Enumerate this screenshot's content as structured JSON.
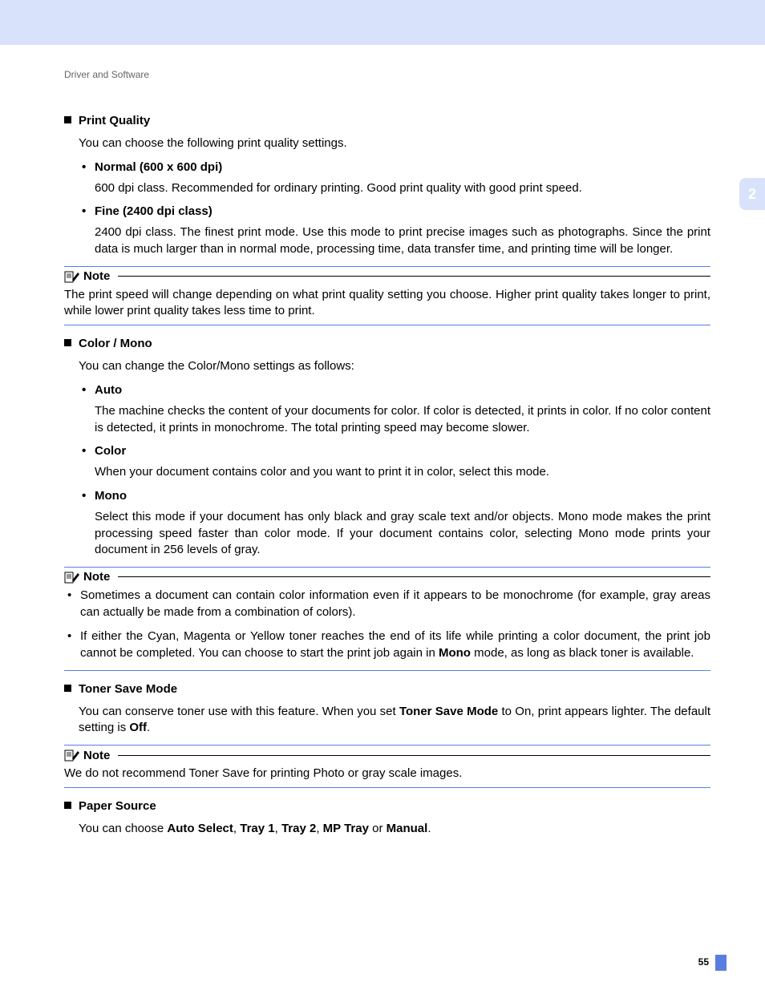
{
  "breadcrumb": "Driver and Software",
  "chapter_tab": "2",
  "page_number": "55",
  "note_label": "Note",
  "sections": {
    "print_quality": {
      "title": "Print Quality",
      "intro": "You can choose the following print quality settings.",
      "items": {
        "normal": {
          "title": "Normal (600 x 600 dpi)",
          "body": "600 dpi class. Recommended for ordinary printing. Good print quality with good print speed."
        },
        "fine": {
          "title": "Fine (2400 dpi class)",
          "body": "2400 dpi class. The finest print mode. Use this mode to print precise images such as photographs. Since the print data is much larger than in normal mode, processing time, data transfer time, and printing time will be longer."
        }
      },
      "note": "The print speed will change depending on what print quality setting you choose. Higher print quality takes longer to print, while lower print quality takes less time to print."
    },
    "color_mono": {
      "title": "Color / Mono",
      "intro": "You can change the Color/Mono settings as follows:",
      "items": {
        "auto": {
          "title": "Auto",
          "body": "The machine checks the content of your documents for color. If color is detected, it prints in color. If no color content is detected, it prints in monochrome. The total printing speed may become slower."
        },
        "color": {
          "title": "Color",
          "body": "When your document contains color and you want to print it in color, select this mode."
        },
        "mono": {
          "title": "Mono",
          "body": "Select this mode if your document has only black and gray scale text and/or objects. Mono mode makes the print processing speed faster than color mode. If your document contains color, selecting Mono mode prints your document in 256 levels of gray."
        }
      },
      "note_bullets": {
        "b1": "Sometimes a document can contain color information even if it appears to be monochrome (for example, gray areas can actually be made from a combination of colors).",
        "b2_pre": "If either the Cyan, Magenta or Yellow toner reaches the end of its life while printing a color document, the print job cannot be completed. You can choose to start the print job again in ",
        "b2_bold": "Mono",
        "b2_post": " mode, as long as black toner is available."
      }
    },
    "toner_save": {
      "title": "Toner Save Mode",
      "body_pre": "You can conserve toner use with this feature. When you set ",
      "body_b1": "Toner Save Mode",
      "body_mid": " to On, print appears lighter. The default setting is ",
      "body_b2": "Off",
      "body_post": ".",
      "note": "We do not recommend Toner Save for printing Photo or gray scale images."
    },
    "paper_source": {
      "title": "Paper Source",
      "body_pre": "You can choose ",
      "opt1": "Auto Select",
      "sep1": ", ",
      "opt2": "Tray 1",
      "sep2": ", ",
      "opt3": "Tray 2",
      "sep3": ", ",
      "opt4": "MP Tray",
      "sep4": " or ",
      "opt5": "Manual",
      "body_post": "."
    }
  }
}
